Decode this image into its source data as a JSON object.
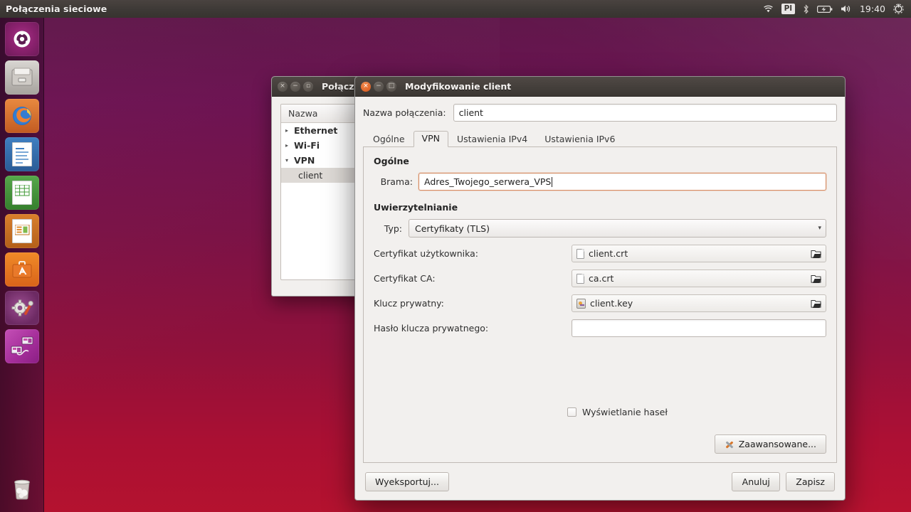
{
  "panel": {
    "title": "Połączenia sieciowe",
    "indicators": [
      {
        "name": "wifi-icon",
        "glyph": "◖"
      },
      {
        "name": "keyboard-layout-indicator",
        "label": "Pl"
      },
      {
        "name": "bluetooth-icon",
        "glyph": "ᛦ"
      },
      {
        "name": "battery-icon",
        "glyph": "▭"
      },
      {
        "name": "volume-icon",
        "glyph": "▶"
      },
      {
        "name": "session-menu-icon",
        "glyph": "⚙"
      }
    ],
    "clock": "19:40"
  },
  "launcher": {
    "items": [
      {
        "name": "dash-home",
        "icon": "ubuntu-logo-icon",
        "glyph": "◌"
      },
      {
        "name": "files",
        "icon": "file-manager-icon",
        "glyph": ""
      },
      {
        "name": "firefox",
        "icon": "firefox-icon",
        "glyph": ""
      },
      {
        "name": "libreoffice-writer",
        "icon": "writer-icon",
        "glyph": ""
      },
      {
        "name": "libreoffice-calc",
        "icon": "calc-icon",
        "glyph": ""
      },
      {
        "name": "libreoffice-impress",
        "icon": "impress-icon",
        "glyph": ""
      },
      {
        "name": "ubuntu-software",
        "icon": "software-center-icon",
        "glyph": "A"
      },
      {
        "name": "system-settings",
        "icon": "gear-wrench-icon",
        "glyph": "⚙"
      },
      {
        "name": "network-connections",
        "icon": "network-icon",
        "glyph": ""
      }
    ],
    "trash": {
      "name": "trash",
      "icon": "trash-icon",
      "glyph": "🗑"
    }
  },
  "nm_window": {
    "title": "Połącze",
    "column_header": "Nazwa",
    "rows": [
      {
        "label": "Ethernet",
        "type": "group",
        "expanded": false,
        "marker": "▸"
      },
      {
        "label": "Wi-Fi",
        "type": "group",
        "expanded": false,
        "marker": "▸"
      },
      {
        "label": "VPN",
        "type": "group",
        "expanded": true,
        "marker": "▾"
      },
      {
        "label": "client",
        "type": "child",
        "selected": true,
        "marker": ""
      }
    ]
  },
  "dialog": {
    "title": "Modyfikowanie client",
    "window_buttons": {
      "close": "×",
      "minimize": "−",
      "maximize": "□"
    },
    "connection_name_label": "Nazwa połączenia:",
    "connection_name_value": "client",
    "tabs": [
      {
        "label": "Ogólne",
        "active": false
      },
      {
        "label": "VPN",
        "active": true
      },
      {
        "label": "Ustawienia IPv4",
        "active": false
      },
      {
        "label": "Ustawienia IPv6",
        "active": false
      }
    ],
    "general_section": {
      "title": "Ogólne",
      "gateway_label": "Brama:",
      "gateway_value": "Adres_Twojego_serwera_VPS"
    },
    "auth_section": {
      "title": "Uwierzytelnianie",
      "type_label": "Typ:",
      "type_value": "Certyfikaty (TLS)",
      "type_chevron": "▾",
      "user_cert_label": "Certyfikat użytkownika:",
      "user_cert_value": "client.crt",
      "ca_cert_label": "Certyfikat CA:",
      "ca_cert_value": "ca.crt",
      "private_key_label": "Klucz prywatny:",
      "private_key_value": "client.key",
      "private_key_password_label": "Hasło klucza prywatnego:",
      "private_key_password_value": "",
      "browse_glyph": "📂"
    },
    "show_passwords_label": "Wyświetlanie haseł",
    "show_passwords_checked": false,
    "advanced_button": "Zaawansowane...",
    "export_button": "Wyeksportuj...",
    "cancel_button": "Anuluj",
    "save_button": "Zapisz"
  },
  "colors": {
    "accent_orange": "#d6541a",
    "panel_bg": "#3e3a37",
    "dialog_bg": "#f2f0ee",
    "focus_border": "#d98e66"
  }
}
